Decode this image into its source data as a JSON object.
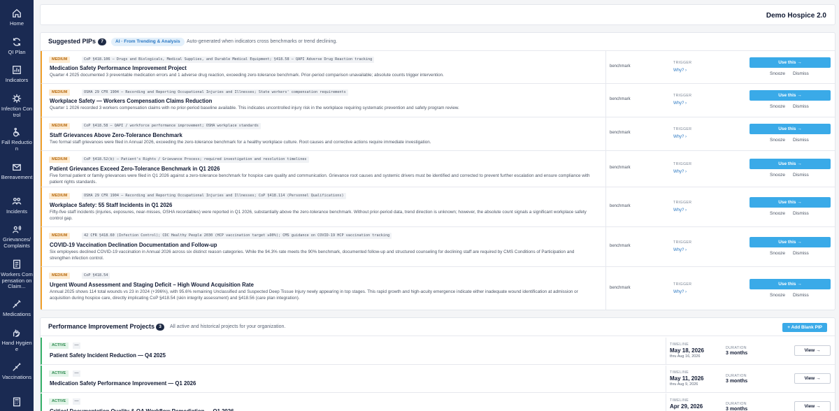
{
  "sidebar": {
    "items": [
      {
        "label": "Home",
        "icon": "home-icon"
      },
      {
        "label": "QI Plan",
        "icon": "refresh-icon"
      },
      {
        "label": "Indicators",
        "icon": "chart-icon"
      },
      {
        "label": "Infection Control",
        "icon": "virus-icon"
      },
      {
        "label": "Fall Reduction",
        "icon": "wheelchair-icon"
      },
      {
        "label": "Bereavement",
        "icon": "mail-heart-icon"
      },
      {
        "label": "Incidents",
        "icon": "people-icon"
      },
      {
        "label": "Grievances/ Complaints",
        "icon": "speaker-person-icon"
      },
      {
        "label": "Workers Compensation on Claim...",
        "icon": "document-icon"
      },
      {
        "label": "Medications",
        "icon": "syringe-icon"
      },
      {
        "label": "Hand Hygiene",
        "icon": "hand-wash-icon"
      },
      {
        "label": "Vaccinations",
        "icon": "needle-icon"
      },
      {
        "label": "",
        "icon": "calculator-icon"
      }
    ]
  },
  "header": {
    "org_name": "Demo Hospice 2.0"
  },
  "suggested": {
    "title": "Suggested PIPs",
    "count": "7",
    "ai_badge": "AI · From Trending & Analysis",
    "description": "Auto-generated when indicators cross benchmarks or trend declining.",
    "trigger_label": "TRIGGER",
    "why_label": "Why? ›",
    "use_label": "Use this →",
    "snooze_label": "Snooze",
    "dismiss_label": "Dismiss",
    "items": [
      {
        "severity": "MEDIUM",
        "citation": "CoP §418.106 — Drugs and Biologicals, Medical Supplies, and Durable Medical Equipment; §418.58 — QAPI Adverse Drug Reaction tracking",
        "title": "Medication Safety Performance Improvement Project",
        "description": "Quarter 4 2025 documented 3 preventable medication errors and 1 adverse drug reaction, exceeding zero-tolerance benchmark. Prior-period comparison unavailable; absolute counts trigger intervention.",
        "kind": "benchmark"
      },
      {
        "severity": "MEDIUM",
        "citation": "OSHA 29 CFR 1904 — Recording and Reporting Occupational Injuries and Illnesses; State workers' compensation requirements",
        "title": "Workplace Safety — Workers Compensation Claims Reduction",
        "description": "Quarter 1 2026 recorded 3 workers compensation claims with no prior-period baseline available. This indicates uncontrolled injury risk in the workplace requiring systematic prevention and safety program review.",
        "kind": "benchmark"
      },
      {
        "severity": "MEDIUM",
        "citation": "CoP §418.58 — QAPI / workforce performance improvement; OSHA workplace standards",
        "title": "Staff Grievances Above Zero-Tolerance Benchmark",
        "description": "Two formal staff grievances were filed in Annual 2026, exceeding the zero-tolerance benchmark for a healthy workplace culture. Root causes and corrective actions require immediate investigation.",
        "kind": "benchmark"
      },
      {
        "severity": "MEDIUM",
        "citation": "CoP §418.52(b) — Patient's Rights / Grievance Process; required investigation and resolution timelines",
        "title": "Patient Grievances Exceed Zero-Tolerance Benchmark in Q1 2026",
        "description": "Five formal patient or family grievances were filed in Q1 2026 against a zero-tolerance benchmark for hospice care quality and communication. Grievance root causes and systemic drivers must be identified and corrected to prevent further escalation and ensure compliance with patient rights standards.",
        "kind": "benchmark"
      },
      {
        "severity": "MEDIUM",
        "citation": "OSHA 29 CFR 1904 — Recording and Reporting Occupational Injuries and Illnesses; CoP §418.114 (Personnel Qualifications)",
        "title": "Workplace Safety: 55 Staff Incidents in Q1 2026",
        "description": "Fifty-five staff incidents (injuries, exposures, near-misses, OSHA recordables) were reported in Q1 2026, substantially above the zero-tolerance benchmark. Without prior-period data, trend direction is unknown; however, the absolute count signals a significant workplace safety control gap.",
        "kind": "benchmark"
      },
      {
        "severity": "MEDIUM",
        "citation": "42 CFR §418.60 (Infection Control); CDC Healthy People 2030 (HCP vaccination target ≥90%); CMS guidance on COVID-19 HCP vaccination tracking",
        "title": "COVID-19 Vaccination Declination Documentation and Follow-up",
        "description": "Six employees declined COVID-19 vaccination in Annual 2026 across six distinct reason categories. While the 94.3% rate meets the 90% benchmark, documented follow-up and structured counseling for declining staff are required by CMS Conditions of Participation and strengthen infection control.",
        "kind": "benchmark"
      },
      {
        "severity": "MEDIUM",
        "citation": "CoP §418.54",
        "title": "Urgent Wound Assessment and Staging Deficit – High Wound Acquisition Rate",
        "description": "Annual 2025 shows 114 total wounds vs 23 in 2024 (+396%), with 95.6% remaining Unclassified and Suspected Deep Tissue Injury newly appearing in top stages. This rapid growth and high-acuity emergence indicate either inadequate wound identification at admission or acquisition during hospice care, directly implicating CoP §418.54 (skin integrity assessment) and §418.56 (care plan integration).",
        "kind": "benchmark"
      }
    ]
  },
  "projects": {
    "title": "Performance Improvement Projects",
    "count": "3",
    "description": "All active and historical projects for your organization.",
    "add_label": "+ Add Blank PIP",
    "timeline_label": "TIMELINE",
    "duration_label": "DURATION",
    "view_label": "View →",
    "items": [
      {
        "status": "ACTIVE",
        "tag": "—",
        "title": "Patient Safety Incident Reduction — Q4 2025",
        "start": "May 18, 2026",
        "thru": "thru Aug 16, 2026",
        "duration": "3 months"
      },
      {
        "status": "ACTIVE",
        "tag": "—",
        "title": "Medication Safety Performance Improvement — Q1 2026",
        "start": "May 11, 2026",
        "thru": "thru Aug 9, 2026",
        "duration": "3 months"
      },
      {
        "status": "ACTIVE",
        "tag": "—",
        "title": "Critical Documentation Quality & QA Workflow Remediation — Q1 2026",
        "start": "Apr 29, 2026",
        "thru": "",
        "duration": "3 months"
      }
    ]
  }
}
